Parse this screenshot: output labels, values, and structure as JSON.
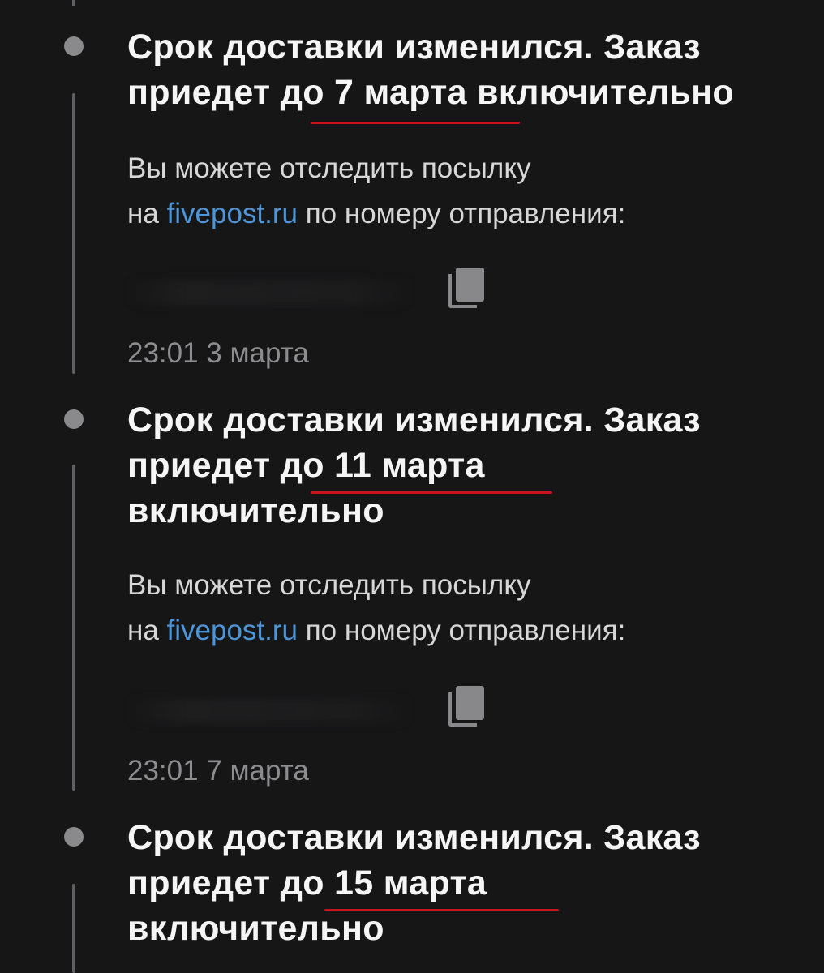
{
  "events": [
    {
      "title_line1": "Срок доставки изменился. Заказ",
      "title_line2": "приедет до 7 марта включительно",
      "title_line3": "",
      "body_line1": "Вы можете отследить посылку",
      "body_prefix": "на ",
      "link_text": "fivepost.ru",
      "body_suffix": " по номеру отправления:",
      "time": "23:01 3 марта"
    },
    {
      "title_line1": "Срок доставки изменился. Заказ",
      "title_line2": "приедет до 11 марта",
      "title_line3": "включительно",
      "body_line1": "Вы можете отследить посылку",
      "body_prefix": "на ",
      "link_text": "fivepost.ru",
      "body_suffix": " по номеру отправления:",
      "time": "23:01 7 марта"
    },
    {
      "title_line1": "Срок доставки изменился. Заказ",
      "title_line2": "приедет до 15 марта",
      "title_line3": "включительно"
    }
  ],
  "icons": {
    "copy": "copy-icon",
    "timeline_dot": "timeline-dot"
  },
  "colors": {
    "background": "#161617",
    "link": "#4c95d9",
    "highlight_underline": "#c8141e",
    "timeline": "#5f5f61"
  }
}
